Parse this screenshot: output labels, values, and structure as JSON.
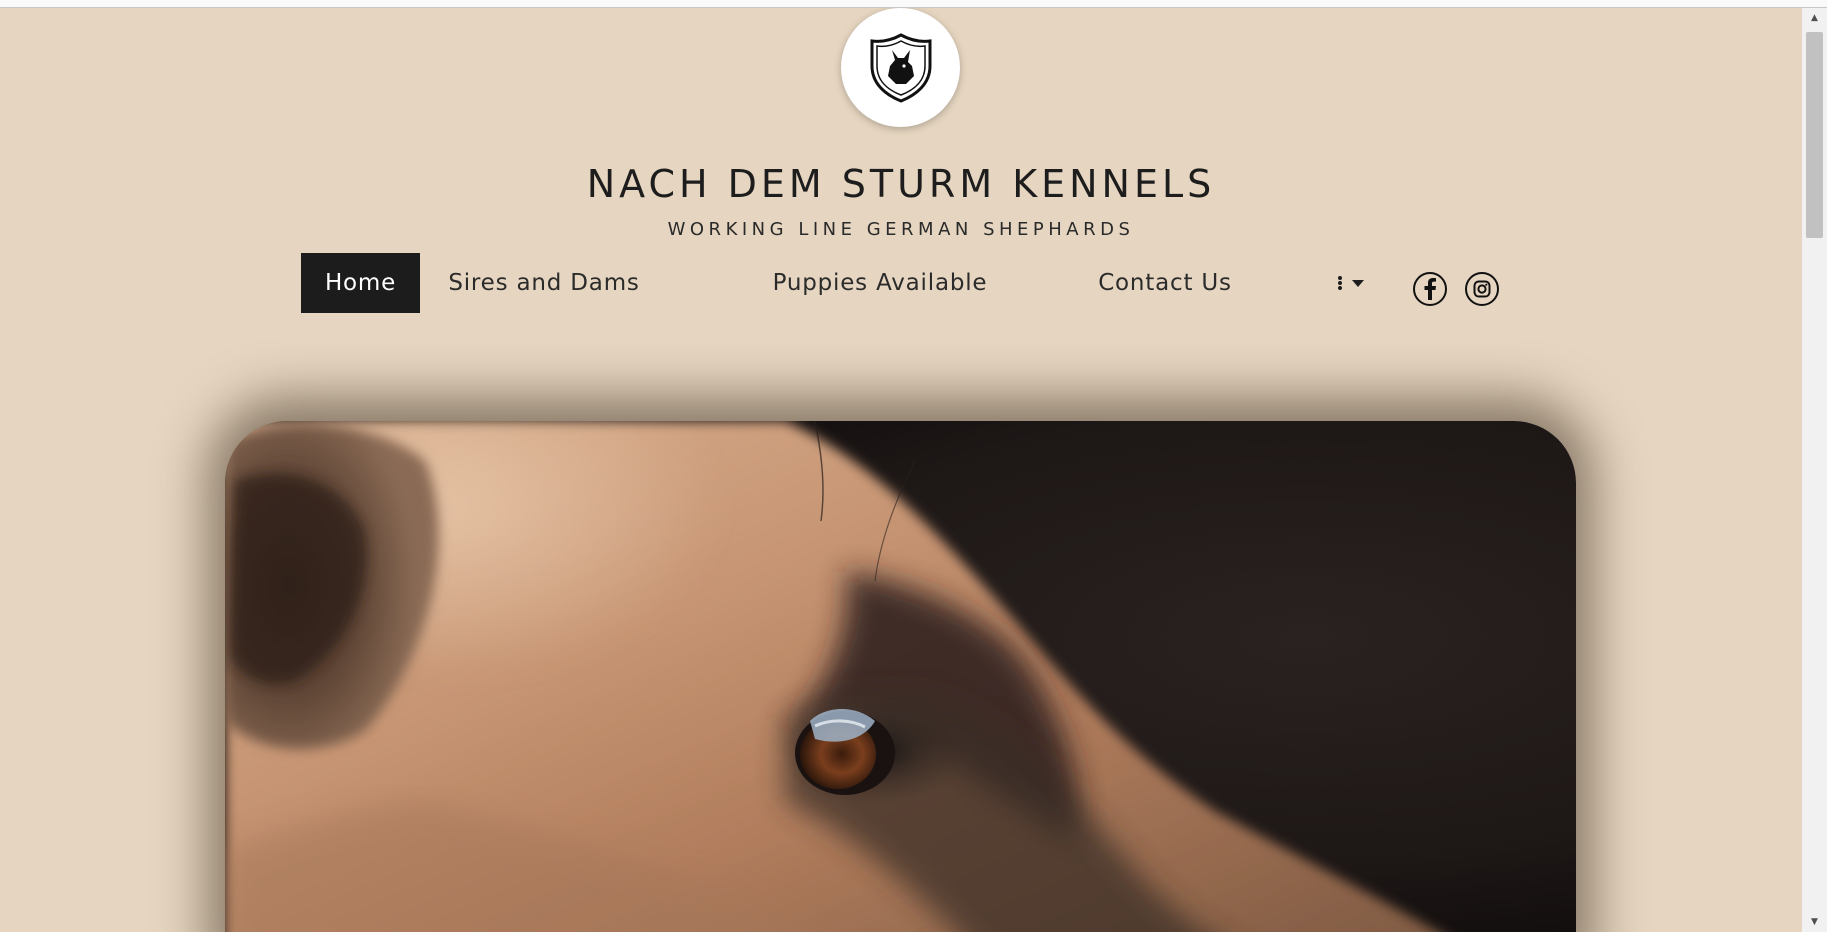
{
  "site": {
    "title": "NACH DEM STURM KENNELS",
    "tagline": "WORKING LINE GERMAN SHEPHARDS"
  },
  "nav": {
    "items": [
      {
        "label": "Home",
        "active": true
      },
      {
        "label": "Sires and Dams",
        "active": false
      },
      {
        "label": "Puppies Available",
        "active": false
      },
      {
        "label": "Contact Us",
        "active": false
      }
    ],
    "more_icon": "kebab-dropdown-icon"
  },
  "social": [
    {
      "icon": "facebook-icon"
    },
    {
      "icon": "instagram-icon"
    }
  ],
  "hero": {
    "subject": "close-up of german shepherd eye"
  },
  "colors": {
    "background": "#e6d6c1",
    "nav_active_bg": "#1c1c1c",
    "text": "#1d1d1d"
  }
}
